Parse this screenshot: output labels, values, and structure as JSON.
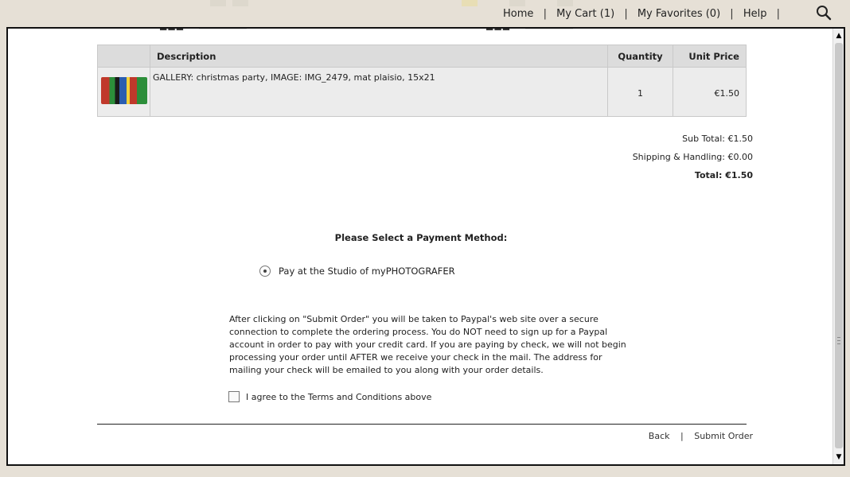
{
  "nav": {
    "home": "Home",
    "cart": "My Cart (1)",
    "favorites": "My Favorites (0)",
    "help": "Help",
    "separator": "|",
    "search_icon": "search-icon"
  },
  "table": {
    "headers": {
      "description": "Description",
      "quantity": "Quantity",
      "unit_price": "Unit Price"
    },
    "rows": [
      {
        "description": "GALLERY: christmas party, IMAGE: IMG_2479, mat plaisio, 15x21",
        "quantity": "1",
        "unit_price": "€1.50"
      }
    ]
  },
  "totals": {
    "subtotal": "Sub Total: €1.50",
    "shipping": "Shipping & Handling: €0.00",
    "total": "Total: €1.50"
  },
  "payment": {
    "title": "Please Select a Payment Method:",
    "option": "Pay at the Studio of myPHOTOGRAFER"
  },
  "notice": "After clicking on \"Submit Order\" you will be taken to Paypal's web site over a secure connection to complete the ordering process. You do NOT need to sign up for a Paypal account in order to pay with your credit card.  If you are paying by check, we will not begin processing your order until AFTER we receive your check in the mail.  The address for mailing your check will be emailed to you along with your order details.",
  "agree_label": "I agree to the Terms and Conditions above",
  "footer": {
    "back": "Back",
    "separator": "|",
    "submit": "Submit Order"
  },
  "colors": {
    "page_bg": "#e6e0d6",
    "table_header_bg": "#dcdcdc",
    "table_row_bg": "#ececec"
  }
}
